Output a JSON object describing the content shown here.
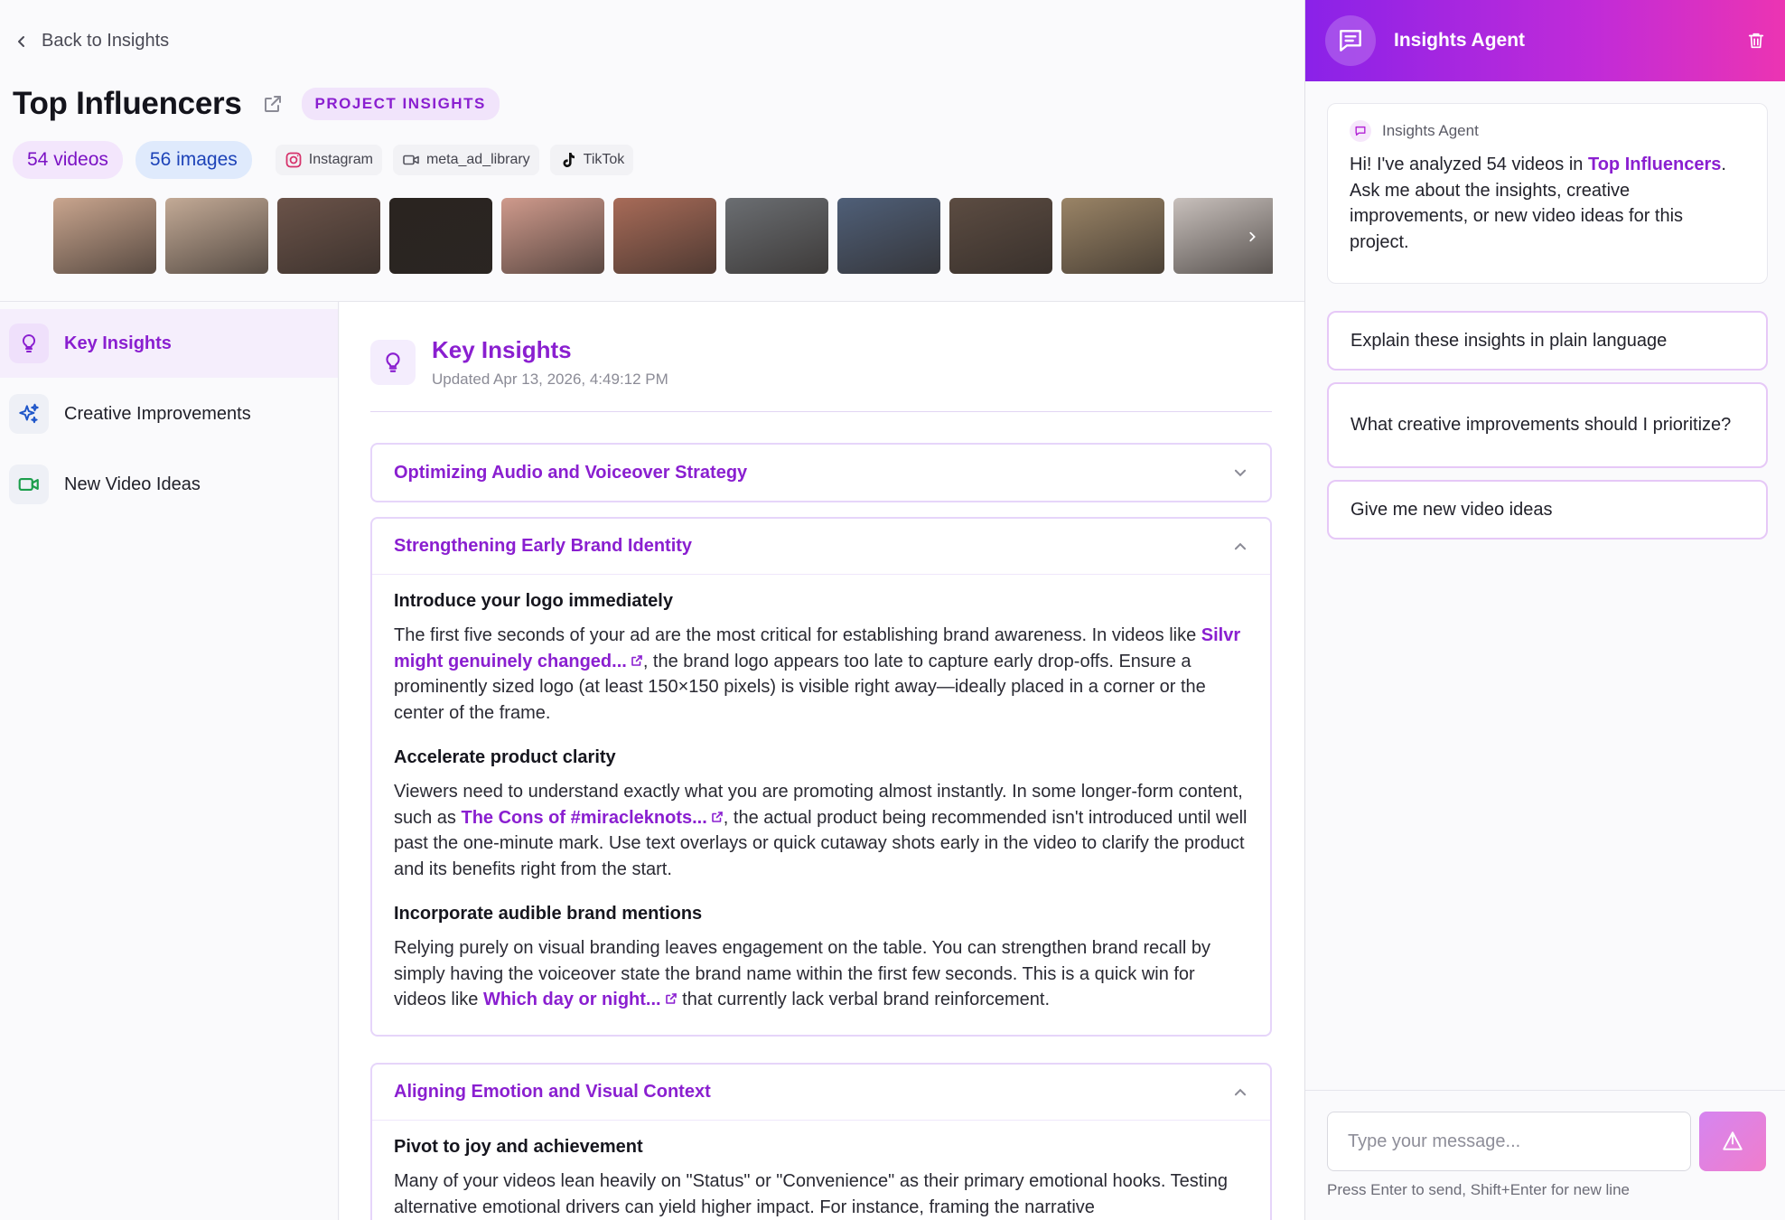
{
  "header": {
    "back_label": "Back to Insights",
    "page_title": "Top Influencers",
    "project_badge": "PROJECT INSIGHTS",
    "videos_chip": "54 videos",
    "images_chip": "56 images",
    "platforms": [
      {
        "label": "Instagram",
        "icon": "instagram-icon"
      },
      {
        "label": "meta_ad_library",
        "icon": "video-camera-icon"
      },
      {
        "label": "TikTok",
        "icon": "tiktok-icon"
      }
    ],
    "thumbnail_colors": [
      "#c9a58e",
      "#c3aa96",
      "#6b5349",
      "#2a2420",
      "#cf9a8c",
      "#a86b58",
      "#6b6e72",
      "#4f5f78",
      "#5c4c42",
      "#9a8466",
      "#c8c0bc"
    ]
  },
  "nav": {
    "items": [
      {
        "label": "Key Insights",
        "icon": "lightbulb-icon",
        "active": true
      },
      {
        "label": "Creative Improvements",
        "icon": "sparkles-icon",
        "active": false
      },
      {
        "label": "New Video Ideas",
        "icon": "video-camera-icon",
        "active": false
      }
    ]
  },
  "content": {
    "title": "Key Insights",
    "updated": "Updated Apr 13, 2026, 4:49:12 PM",
    "accordions": [
      {
        "title": "Optimizing Audio and Voiceover Strategy",
        "expanded": false
      },
      {
        "title": "Strengthening Early Brand Identity",
        "expanded": true,
        "sections": [
          {
            "heading": "Introduce your logo immediately",
            "before": "The first five seconds of your ad are the most critical for establishing brand awareness. In videos like ",
            "link": "Silvr might genuinely changed...",
            "after": ", the brand logo appears too late to capture early drop-offs. Ensure a prominently sized logo (at least 150×150 pixels) is visible right away—ideally placed in a corner or the center of the frame."
          },
          {
            "heading": "Accelerate product clarity",
            "before": "Viewers need to understand exactly what you are promoting almost instantly. In some longer-form content, such as ",
            "link": "The Cons of #miracleknots...",
            "after": ", the actual product being recommended isn't introduced until well past the one-minute mark. Use text overlays or quick cutaway shots early in the video to clarify the product and its benefits right from the start."
          },
          {
            "heading": "Incorporate audible brand mentions",
            "before": "Relying purely on visual branding leaves engagement on the table. You can strengthen brand recall by simply having the voiceover state the brand name within the first few seconds. This is a quick win for videos like ",
            "link": "Which day or night...",
            "after": " that currently lack verbal brand reinforcement."
          }
        ]
      },
      {
        "title": "Aligning Emotion and Visual Context",
        "expanded": true,
        "sections": [
          {
            "heading": "Pivot to joy and achievement",
            "text": "Many of your videos lean heavily on \"Status\" or \"Convenience\" as their primary emotional hooks. Testing alternative emotional drivers can yield higher impact. For instance, framing the narrative"
          }
        ]
      }
    ]
  },
  "chat": {
    "title": "Insights Agent",
    "message": {
      "from": "Insights Agent",
      "before": "Hi! I've analyzed 54 videos in ",
      "highlight": "Top Influencers",
      "after": ". Ask me about the insights, creative improvements, or new video ideas for this project."
    },
    "suggestions": [
      "Explain these insights in plain language",
      "What creative improvements should I prioritize?",
      "Give me new video ideas"
    ],
    "input_placeholder": "Type your message...",
    "hint": "Press Enter to send, Shift+Enter for new line"
  },
  "colors": {
    "accent": "#8a1fd0",
    "chat_gradient_start": "#8a22e8",
    "chat_gradient_end": "#ec34b2"
  }
}
